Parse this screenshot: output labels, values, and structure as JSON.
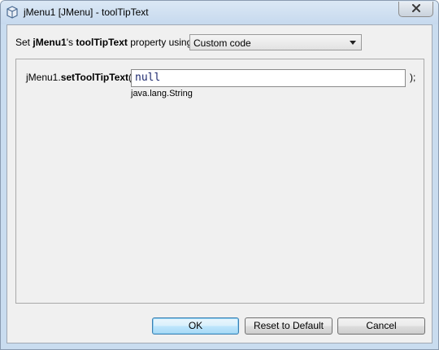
{
  "window": {
    "title": "jMenu1 [JMenu] - toolTipText"
  },
  "property_line": {
    "prefix": "Set ",
    "component": "jMenu1",
    "possessive": "'s ",
    "property": "toolTipText",
    "suffix": " property using:"
  },
  "mode_select": {
    "value": "Custom code"
  },
  "code_editor": {
    "object_name": "jMenu1.",
    "method": "setToolTipText",
    "open_paren": "(",
    "value": "null",
    "close": ");",
    "type_hint": "java.lang.String"
  },
  "buttons": {
    "ok": "OK",
    "reset": "Reset to Default",
    "cancel": "Cancel"
  }
}
